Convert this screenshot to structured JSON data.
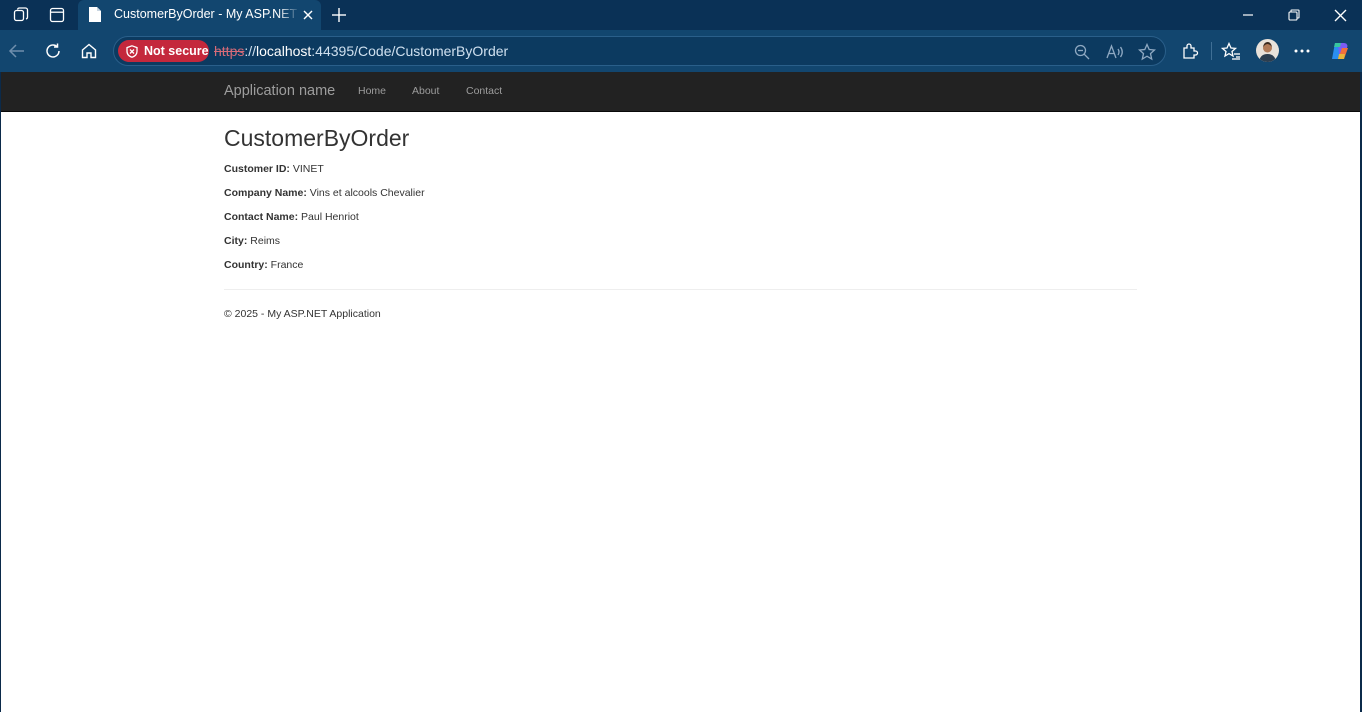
{
  "browser": {
    "tab": {
      "title": "CustomerByOrder - My ASP.NET Application"
    },
    "security": {
      "label": "Not secure"
    },
    "url": {
      "scheme": "https",
      "rest_sep": "://",
      "host": "localhost",
      "path": ":44395/Code/CustomerByOrder"
    },
    "colors": {
      "chrome": "#0a3156",
      "toolbar": "#12466f",
      "warning": "#c4283c"
    }
  },
  "site": {
    "brand": "Application name",
    "nav": [
      {
        "label": "Home"
      },
      {
        "label": "About"
      },
      {
        "label": "Contact"
      }
    ],
    "colors": {
      "navbar": "#222222",
      "navtext": "#9d9d9d",
      "text": "#333333"
    }
  },
  "page": {
    "title": "CustomerByOrder",
    "fields": [
      {
        "label": "Customer ID:",
        "value": "VINET"
      },
      {
        "label": "Company Name:",
        "value": "Vins et alcools Chevalier"
      },
      {
        "label": "Contact Name:",
        "value": "Paul Henriot"
      },
      {
        "label": "City:",
        "value": "Reims"
      },
      {
        "label": "Country:",
        "value": "France"
      }
    ],
    "footer": "© 2025 - My ASP.NET Application"
  }
}
